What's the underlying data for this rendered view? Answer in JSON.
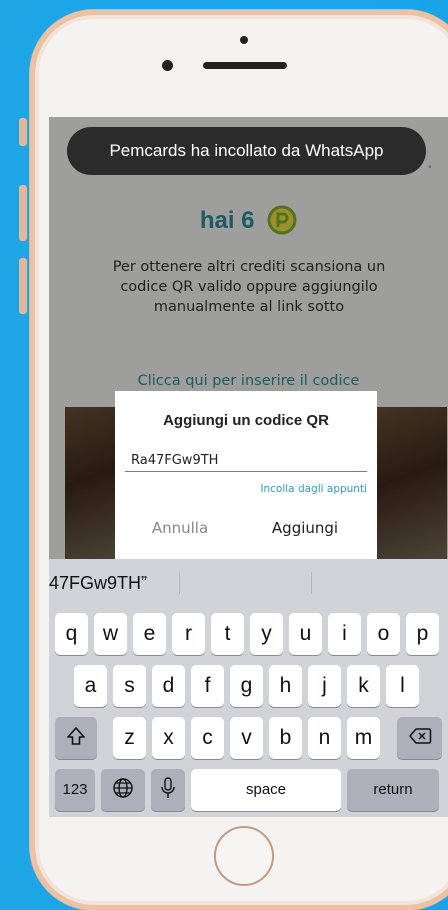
{
  "toast": {
    "text": "Pemcards ha incollato da WhatsApp"
  },
  "header": {
    "partial": "."
  },
  "credits": {
    "prefix": "hai 6"
  },
  "description": "Per ottenere altri crediti scansiona un codice QR valido oppure aggiungilo manualmente al link sotto",
  "manual_link": "Clicca qui per inserire il codice",
  "dialog": {
    "title": "Aggiungi un codice QR",
    "input_value": "Ra47FGw9TH",
    "paste_label": "Incolla dagli appunti",
    "cancel_label": "Annulla",
    "add_label": "Aggiungi"
  },
  "keyboard": {
    "suggestion": "47FGw9TH”",
    "row1": [
      "q",
      "w",
      "e",
      "r",
      "t",
      "y",
      "u",
      "i",
      "o",
      "p"
    ],
    "row2": [
      "a",
      "s",
      "d",
      "f",
      "g",
      "h",
      "j",
      "k",
      "l"
    ],
    "row3": [
      "z",
      "x",
      "c",
      "v",
      "b",
      "n",
      "m"
    ],
    "numbers_label": "123",
    "space_label": "space",
    "return_label": "return"
  },
  "colors": {
    "accent": "#2c8f9c",
    "keyboard_bg": "#d1d3d9"
  }
}
